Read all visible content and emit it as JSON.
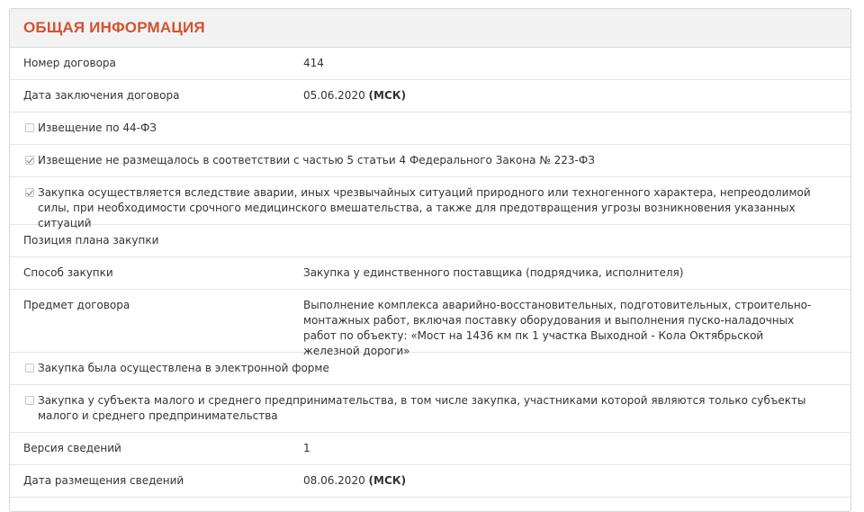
{
  "section": {
    "title": "ОБЩАЯ ИНФОРМАЦИЯ"
  },
  "rows": {
    "contract_number": {
      "label": "Номер договора",
      "value": "414"
    },
    "contract_date": {
      "label": "Дата заключения договора",
      "date": "05.06.2020",
      "tz": "(МСК)"
    },
    "notice_44fz": {
      "label": "Извещение по 44-ФЗ",
      "checked": false
    },
    "notice_not_placed": {
      "label": "Извещение не размещалось в соответствии с частью 5 статьи 4 Федерального Закона № 223-ФЗ",
      "checked": true
    },
    "emergency_purchase": {
      "label": "Закупка осуществляется вследствие аварии, иных чрезвычайных ситуаций природного или техногенного характера, непреодолимой силы, при необходимости срочного медицинского вмешательства, а также для предотвращения угрозы возникновения указанных ситуаций",
      "checked": true
    },
    "plan_position": {
      "label": "Позиция плана закупки",
      "value": ""
    },
    "purchase_method": {
      "label": "Способ закупки",
      "value": "Закупка у единственного поставщика (подрядчика, исполнителя)"
    },
    "contract_subject": {
      "label": "Предмет договора",
      "value": "Выполнение комплекса аварийно-восстановительных, подготовительных, строительно-монтажных работ, включая поставку оборудования и выполнения пуско-наладочных работ по объекту: «Мост на 1436 км пк 1 участка Выходной - Кола Октябрьской железной дороги»"
    },
    "electronic_form": {
      "label": "Закупка была осуществлена в электронной форме",
      "checked": false
    },
    "sme_purchase": {
      "label": "Закупка у субъекта малого и среднего предпринимательства, в том числе закупка, участниками которой являются только субъекты малого и среднего предпринимательства",
      "checked": false
    },
    "info_version": {
      "label": "Версия сведений",
      "value": "1"
    },
    "publish_date": {
      "label": "Дата размещения сведений",
      "date": "08.06.2020",
      "tz": "(МСК)"
    }
  }
}
